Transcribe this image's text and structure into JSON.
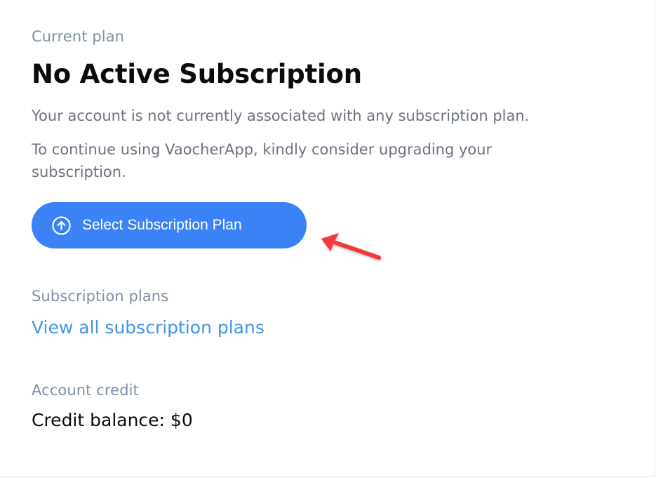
{
  "current_plan": {
    "label": "Current plan",
    "title": "No Active Subscription",
    "message": "Your account is not currently associated with any subscription plan.",
    "prompt": "To continue using VaocherApp, kindly consider upgrading your subscription.",
    "cta_label": "Select Subscription Plan",
    "cta_icon": "arrow-up-circle-icon"
  },
  "subscription_plans": {
    "label": "Subscription plans",
    "link_text": "View all subscription plans"
  },
  "account_credit": {
    "label": "Account credit",
    "balance_text": "Credit balance: $0"
  },
  "colors": {
    "accent": "#3b82f6",
    "link": "#4096e8",
    "annotation_arrow": "#ef3a3a"
  }
}
